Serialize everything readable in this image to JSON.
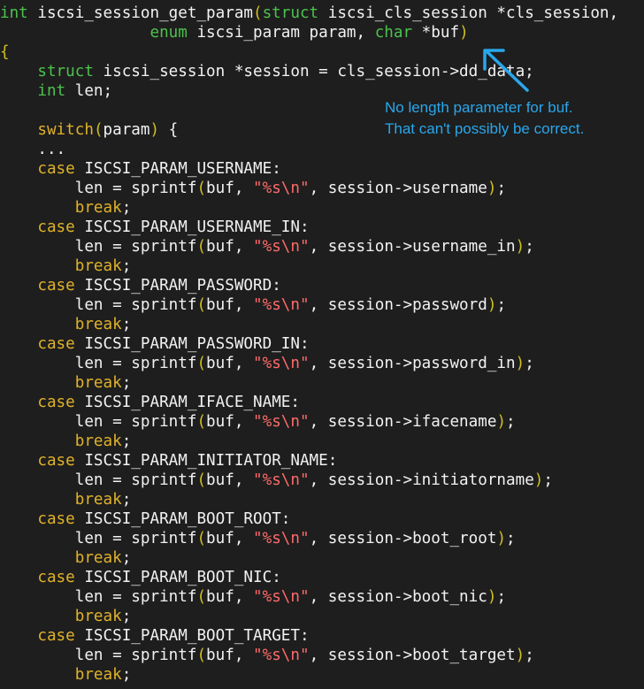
{
  "colors": {
    "background": "#1e1e1e",
    "type_keyword": "#4cc24c",
    "control_keyword": "#e0b22a",
    "paren": "#d0c020",
    "string": "#ff6a6a",
    "text": "#f2f2f2",
    "annotation": "#29a7ec"
  },
  "annotation": {
    "line1": "No length parameter for buf.",
    "line2": "That can't possibly be correct."
  },
  "code": [
    [
      [
        "int",
        "t"
      ],
      [
        " iscsi_session_get_param",
        "p"
      ],
      [
        "(",
        "b"
      ],
      [
        "struct",
        "t"
      ],
      [
        " iscsi_cls_session *cls_session,",
        "p"
      ]
    ],
    [
      [
        "                ",
        "p"
      ],
      [
        "enum",
        "t"
      ],
      [
        " iscsi_param param, ",
        "p"
      ],
      [
        "char",
        "t"
      ],
      [
        " *buf",
        "p"
      ],
      [
        ")",
        "b"
      ]
    ],
    [
      [
        "{",
        "b"
      ]
    ],
    [
      [
        "    ",
        "p"
      ],
      [
        "struct",
        "t"
      ],
      [
        " iscsi_session *session = cls_session->dd_data;",
        "p"
      ]
    ],
    [
      [
        "    ",
        "p"
      ],
      [
        "int",
        "t"
      ],
      [
        " len;",
        "p"
      ]
    ],
    [],
    [
      [
        "    ",
        "p"
      ],
      [
        "switch",
        "c"
      ],
      [
        "(",
        "b"
      ],
      [
        "param",
        "p"
      ],
      [
        ")",
        "b"
      ],
      [
        " {",
        "p"
      ]
    ],
    [
      [
        "    ...",
        "p"
      ]
    ],
    [
      [
        "    ",
        "p"
      ],
      [
        "case",
        "c"
      ],
      [
        " ISCSI_PARAM_USERNAME:",
        "p"
      ]
    ],
    [
      [
        "        len = sprintf",
        "p"
      ],
      [
        "(",
        "b"
      ],
      [
        "buf, ",
        "p"
      ],
      [
        "\"%s\\n\"",
        "s"
      ],
      [
        ", session->username",
        "p"
      ],
      [
        ")",
        "b"
      ],
      [
        ";",
        "p"
      ]
    ],
    [
      [
        "        ",
        "p"
      ],
      [
        "break",
        "c"
      ],
      [
        ";",
        "p"
      ]
    ],
    [
      [
        "    ",
        "p"
      ],
      [
        "case",
        "c"
      ],
      [
        " ISCSI_PARAM_USERNAME_IN:",
        "p"
      ]
    ],
    [
      [
        "        len = sprintf",
        "p"
      ],
      [
        "(",
        "b"
      ],
      [
        "buf, ",
        "p"
      ],
      [
        "\"%s\\n\"",
        "s"
      ],
      [
        ", session->username_in",
        "p"
      ],
      [
        ")",
        "b"
      ],
      [
        ";",
        "p"
      ]
    ],
    [
      [
        "        ",
        "p"
      ],
      [
        "break",
        "c"
      ],
      [
        ";",
        "p"
      ]
    ],
    [
      [
        "    ",
        "p"
      ],
      [
        "case",
        "c"
      ],
      [
        " ISCSI_PARAM_PASSWORD:",
        "p"
      ]
    ],
    [
      [
        "        len = sprintf",
        "p"
      ],
      [
        "(",
        "b"
      ],
      [
        "buf, ",
        "p"
      ],
      [
        "\"%s\\n\"",
        "s"
      ],
      [
        ", session->password",
        "p"
      ],
      [
        ")",
        "b"
      ],
      [
        ";",
        "p"
      ]
    ],
    [
      [
        "        ",
        "p"
      ],
      [
        "break",
        "c"
      ],
      [
        ";",
        "p"
      ]
    ],
    [
      [
        "    ",
        "p"
      ],
      [
        "case",
        "c"
      ],
      [
        " ISCSI_PARAM_PASSWORD_IN:",
        "p"
      ]
    ],
    [
      [
        "        len = sprintf",
        "p"
      ],
      [
        "(",
        "b"
      ],
      [
        "buf, ",
        "p"
      ],
      [
        "\"%s\\n\"",
        "s"
      ],
      [
        ", session->password_in",
        "p"
      ],
      [
        ")",
        "b"
      ],
      [
        ";",
        "p"
      ]
    ],
    [
      [
        "        ",
        "p"
      ],
      [
        "break",
        "c"
      ],
      [
        ";",
        "p"
      ]
    ],
    [
      [
        "    ",
        "p"
      ],
      [
        "case",
        "c"
      ],
      [
        " ISCSI_PARAM_IFACE_NAME:",
        "p"
      ]
    ],
    [
      [
        "        len = sprintf",
        "p"
      ],
      [
        "(",
        "b"
      ],
      [
        "buf, ",
        "p"
      ],
      [
        "\"%s\\n\"",
        "s"
      ],
      [
        ", session->ifacename",
        "p"
      ],
      [
        ")",
        "b"
      ],
      [
        ";",
        "p"
      ]
    ],
    [
      [
        "        ",
        "p"
      ],
      [
        "break",
        "c"
      ],
      [
        ";",
        "p"
      ]
    ],
    [
      [
        "    ",
        "p"
      ],
      [
        "case",
        "c"
      ],
      [
        " ISCSI_PARAM_INITIATOR_NAME:",
        "p"
      ]
    ],
    [
      [
        "        len = sprintf",
        "p"
      ],
      [
        "(",
        "b"
      ],
      [
        "buf, ",
        "p"
      ],
      [
        "\"%s\\n\"",
        "s"
      ],
      [
        ", session->initiatorname",
        "p"
      ],
      [
        ")",
        "b"
      ],
      [
        ";",
        "p"
      ]
    ],
    [
      [
        "        ",
        "p"
      ],
      [
        "break",
        "c"
      ],
      [
        ";",
        "p"
      ]
    ],
    [
      [
        "    ",
        "p"
      ],
      [
        "case",
        "c"
      ],
      [
        " ISCSI_PARAM_BOOT_ROOT:",
        "p"
      ]
    ],
    [
      [
        "        len = sprintf",
        "p"
      ],
      [
        "(",
        "b"
      ],
      [
        "buf, ",
        "p"
      ],
      [
        "\"%s\\n\"",
        "s"
      ],
      [
        ", session->boot_root",
        "p"
      ],
      [
        ")",
        "b"
      ],
      [
        ";",
        "p"
      ]
    ],
    [
      [
        "        ",
        "p"
      ],
      [
        "break",
        "c"
      ],
      [
        ";",
        "p"
      ]
    ],
    [
      [
        "    ",
        "p"
      ],
      [
        "case",
        "c"
      ],
      [
        " ISCSI_PARAM_BOOT_NIC:",
        "p"
      ]
    ],
    [
      [
        "        len = sprintf",
        "p"
      ],
      [
        "(",
        "b"
      ],
      [
        "buf, ",
        "p"
      ],
      [
        "\"%s\\n\"",
        "s"
      ],
      [
        ", session->boot_nic",
        "p"
      ],
      [
        ")",
        "b"
      ],
      [
        ";",
        "p"
      ]
    ],
    [
      [
        "        ",
        "p"
      ],
      [
        "break",
        "c"
      ],
      [
        ";",
        "p"
      ]
    ],
    [
      [
        "    ",
        "p"
      ],
      [
        "case",
        "c"
      ],
      [
        " ISCSI_PARAM_BOOT_TARGET:",
        "p"
      ]
    ],
    [
      [
        "        len = sprintf",
        "p"
      ],
      [
        "(",
        "b"
      ],
      [
        "buf, ",
        "p"
      ],
      [
        "\"%s\\n\"",
        "s"
      ],
      [
        ", session->boot_target",
        "p"
      ],
      [
        ")",
        "b"
      ],
      [
        ";",
        "p"
      ]
    ],
    [
      [
        "        ",
        "p"
      ],
      [
        "break",
        "c"
      ],
      [
        ";",
        "p"
      ]
    ]
  ]
}
